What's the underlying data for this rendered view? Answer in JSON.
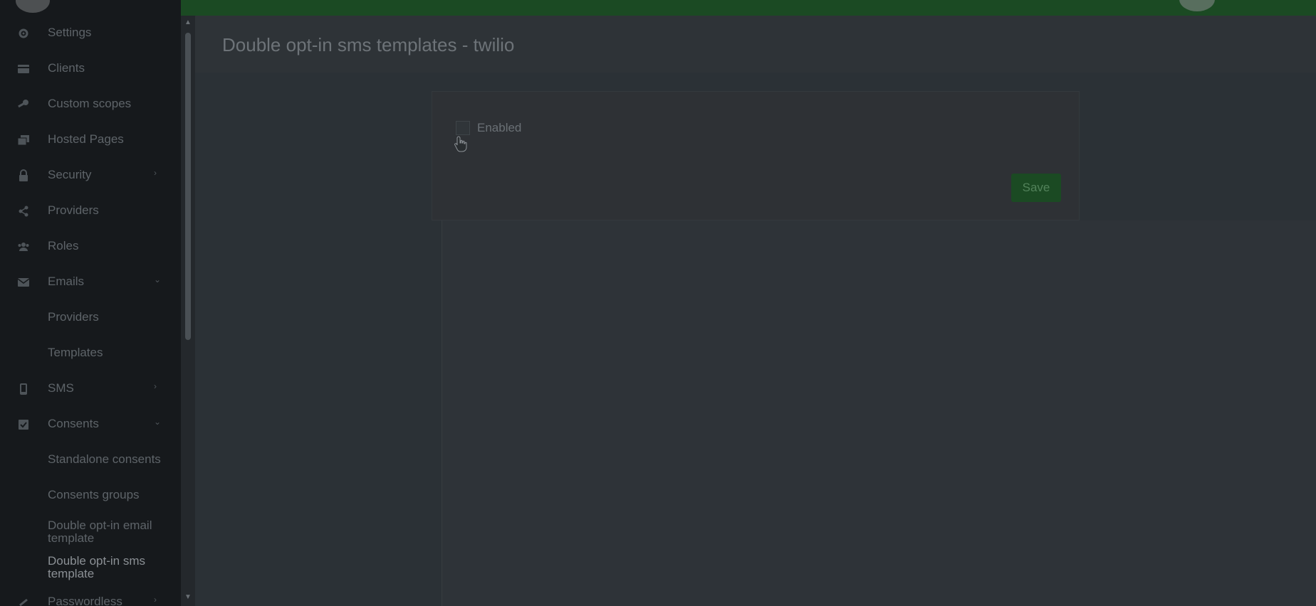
{
  "page": {
    "title": "Double opt-in sms templates - twilio"
  },
  "sidebar": {
    "items": [
      {
        "label": "Settings",
        "icon": "gear-icon"
      },
      {
        "label": "Clients",
        "icon": "card-icon"
      },
      {
        "label": "Custom scopes",
        "icon": "key-icon"
      },
      {
        "label": "Hosted Pages",
        "icon": "pages-icon"
      },
      {
        "label": "Security",
        "icon": "lock-icon",
        "chevron": "right"
      },
      {
        "label": "Providers",
        "icon": "share-icon"
      },
      {
        "label": "Roles",
        "icon": "users-icon"
      },
      {
        "label": "Emails",
        "icon": "envelope-icon",
        "chevron": "down"
      }
    ],
    "email_sub": [
      {
        "label": "Providers"
      },
      {
        "label": "Templates"
      }
    ],
    "sms": {
      "label": "SMS",
      "icon": "mobile-icon",
      "chevron": "right"
    },
    "consents": {
      "label": "Consents",
      "icon": "checkbox-icon",
      "chevron": "down"
    },
    "consents_sub": [
      {
        "label": "Standalone consents"
      },
      {
        "label": "Consents groups"
      },
      {
        "label": "Double opt-in email template"
      },
      {
        "label": "Double opt-in sms template"
      }
    ],
    "passwordless": {
      "label": "Passwordless",
      "icon": "link-icon",
      "chevron": "right"
    }
  },
  "form": {
    "enabled_label": "Enabled",
    "enabled_checked": false,
    "save_label": "Save"
  },
  "colors": {
    "topbar": "#1b4a23",
    "sidebar": "#16191c",
    "save_button": "#1b4a23"
  }
}
